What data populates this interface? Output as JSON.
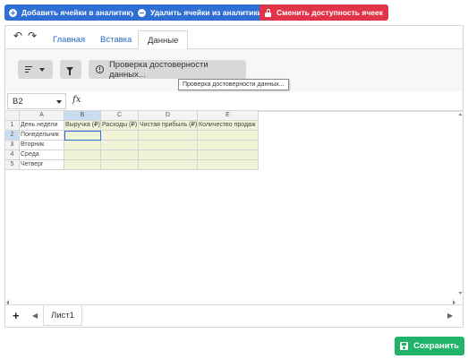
{
  "actions": {
    "add_cells": "Добавить ячейки в аналитику",
    "remove_cells": "Удалить ячейки из аналитики",
    "change_access": "Сменить доступность ячеек",
    "add_color": "#2f6fd3",
    "remove_color": "#2f6fd3",
    "change_color": "#e0344a"
  },
  "tabs": [
    "Главная",
    "Вставка",
    "Данные"
  ],
  "active_tab": "Данные",
  "ribbon": {
    "validate_label": "Проверка достоверности данных...",
    "tooltip": "Проверка достоверности данных..."
  },
  "formula_bar": {
    "cell_ref": "B2",
    "fx": "fx",
    "value": ""
  },
  "grid": {
    "columns": [
      "A",
      "B",
      "C",
      "D",
      "E"
    ],
    "selected_column": "B",
    "selected_row": "2",
    "rows": [
      {
        "num": "1",
        "cells": [
          "День недели",
          "Выручка (₽)",
          "Расходы (₽)",
          "Чистая прибыль (₽)",
          "Количество продаж"
        ]
      },
      {
        "num": "2",
        "cells": [
          "Понедельник",
          "",
          "",
          "",
          ""
        ]
      },
      {
        "num": "3",
        "cells": [
          "Вторник",
          "",
          "",
          "",
          ""
        ]
      },
      {
        "num": "4",
        "cells": [
          "Среда",
          "",
          "",
          "",
          ""
        ]
      },
      {
        "num": "5",
        "cells": [
          "Четверг",
          "",
          "",
          "",
          ""
        ]
      }
    ]
  },
  "sheets": {
    "add": "+",
    "items": [
      "Лист1"
    ]
  },
  "save_label": "Сохранить",
  "save_color": "#21b36a"
}
